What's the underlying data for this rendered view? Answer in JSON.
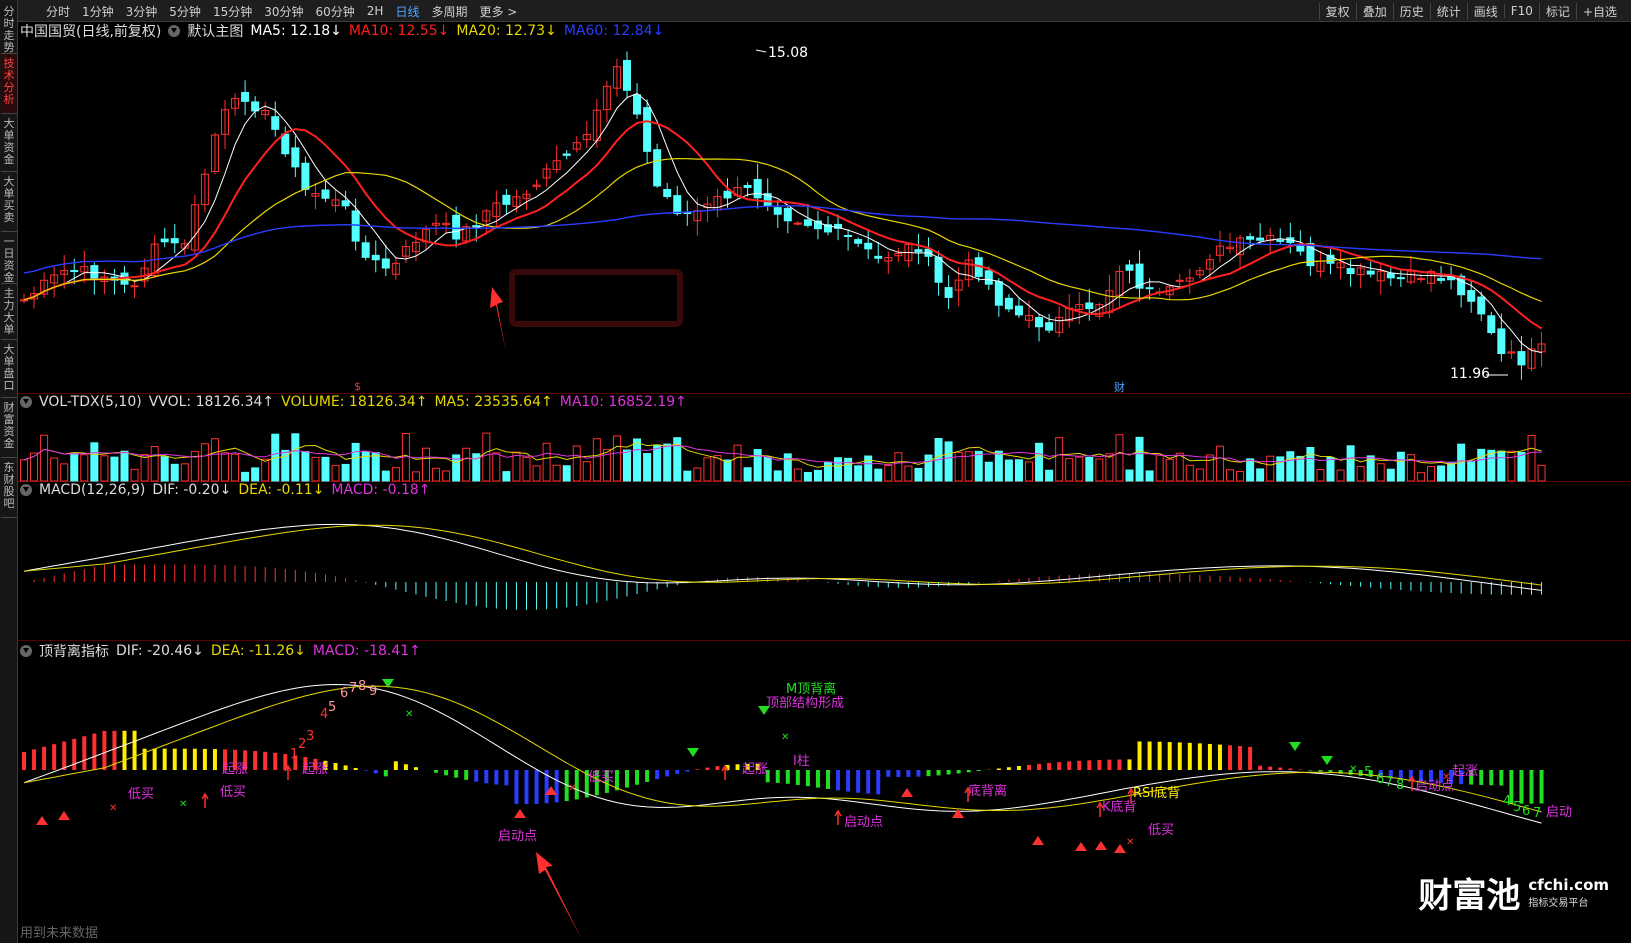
{
  "toolbar": {
    "periods": [
      "分时",
      "1分钟",
      "3分钟",
      "5分钟",
      "15分钟",
      "30分钟",
      "60分钟",
      "2H",
      "日线",
      "多周期",
      "更多 >"
    ],
    "active_period": "日线",
    "right_buttons": [
      "复权",
      "叠加",
      "历史",
      "统计",
      "画线",
      "F10",
      "标记",
      "+自选"
    ]
  },
  "sidebar": {
    "tabs": [
      "分时走势",
      "技术分析",
      "大单资金",
      "大单买卖",
      "一日资金",
      "主力大单",
      "大单盘口",
      "财富资金",
      "东财股吧"
    ],
    "active": "技术分析"
  },
  "main_panel": {
    "stock": "中国国贸(日线,前复权)",
    "template": "默认主图",
    "ma5": "MA5: 12.18↓",
    "ma10": "MA10: 12.55↓",
    "ma20": "MA20: 12.73↓",
    "ma60": "MA60: 12.84↓",
    "high_label": "15.08",
    "low_label": "11.96",
    "event_marks": [
      "$",
      "财"
    ]
  },
  "volume_panel": {
    "name": "VOL-TDX(5,10)",
    "vvol": "VVOL: 18126.34↑",
    "volume": "VOLUME: 18126.34↑",
    "ma5": "MA5: 23535.64↑",
    "ma10": "MA10: 16852.19↑"
  },
  "macd_panel": {
    "name": "MACD(12,26,9)",
    "dif": "DIF: -0.20↓",
    "dea": "DEA: -0.11↓",
    "macd": "MACD: -0.18↑"
  },
  "divergence_panel": {
    "name": "顶背离指标",
    "dif": "DIF: -20.46↓",
    "dea": "DEA: -11.26↓",
    "macd": "MACD: -18.41↑",
    "labels": [
      "低买",
      "低买",
      "起涨",
      "起涨",
      "启动点",
      "低买",
      "起涨",
      "M顶背离",
      "顶部结构形成",
      "I柱",
      "启动点",
      "底背离",
      "K底背",
      "RSI底背",
      "低买",
      "启动点",
      "起涨",
      "启动"
    ],
    "count_marks": [
      "1",
      "2",
      "3",
      "4",
      "5",
      "6",
      "7",
      "8",
      "9",
      "5",
      "6",
      "7",
      "8",
      "4",
      "5",
      "6",
      "7"
    ]
  },
  "colors": {
    "up": "#ff3030",
    "down": "#54ffff",
    "ma5": "#ffffff",
    "ma10": "#ff2020",
    "ma20": "#e6d800",
    "ma60": "#2a3cff",
    "purple": "#dd33dd",
    "green": "#22dd22",
    "blue": "#2a3cff",
    "yellow": "#ffee00"
  },
  "watermark": {
    "brand": "财富池",
    "domain": "cfchi.com",
    "slogan": "指标交易平台"
  },
  "footnote": "用到未来数据"
}
